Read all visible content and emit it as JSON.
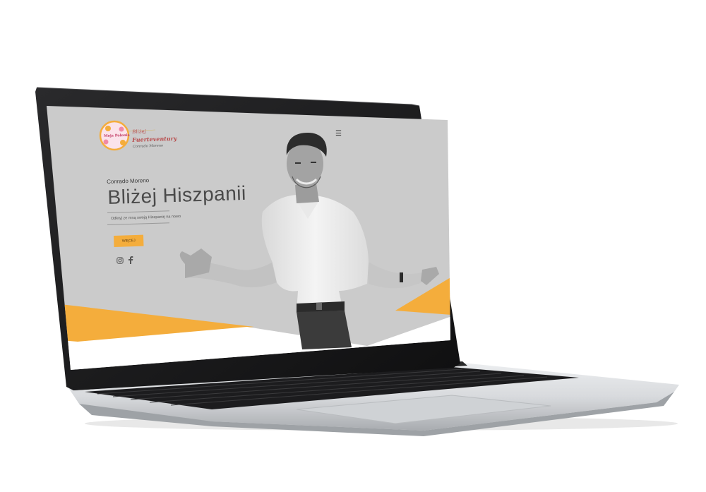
{
  "site": {
    "logo": {
      "badge_text": "Moja Polonia",
      "line1": "Bliżej",
      "line2": "Fuerteventury",
      "signature": "Conrado Moreno",
      "ring_color": "#f4ad3c",
      "inner_color": "#fbe3ea"
    },
    "menu_icon": "hamburger-icon",
    "hero": {
      "name": "Conrado Moreno",
      "title": "Bliżej Hiszpanii",
      "tagline": "Odkryj ze mną swoją Hiszpanię na nowo",
      "cta_label": "WIĘCEJ"
    },
    "social": [
      {
        "icon": "instagram-icon"
      },
      {
        "icon": "facebook-icon"
      }
    ],
    "colors": {
      "background": "#cbcbcb",
      "accent": "#f4ad3c",
      "title": "#4a4a4a"
    }
  }
}
